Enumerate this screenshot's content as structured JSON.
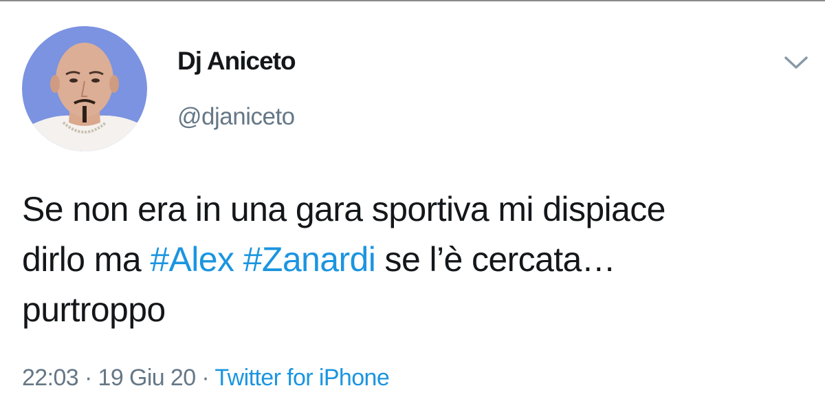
{
  "tweet": {
    "author": {
      "display_name": "Dj Aniceto",
      "handle": "@djaniceto"
    },
    "text": {
      "line1": "Se non era in una gara sportiva mi dispiace",
      "line2_start": "dirlo ma ",
      "hashtag1": "#Alex",
      "space": " ",
      "hashtag2": "#Zanardi",
      "line2_end": " se l’è cercata…",
      "line3": "purtroppo"
    },
    "meta": {
      "time": "22:03",
      "separator": " · ",
      "date": "19 Giu 20",
      "source": "Twitter for iPhone"
    },
    "icons": {
      "menu": "chevron-down-icon"
    },
    "colors": {
      "text": "#14171a",
      "secondary": "#657786",
      "link": "#1b95e0",
      "avatar_bg": "#7b93e0"
    }
  }
}
